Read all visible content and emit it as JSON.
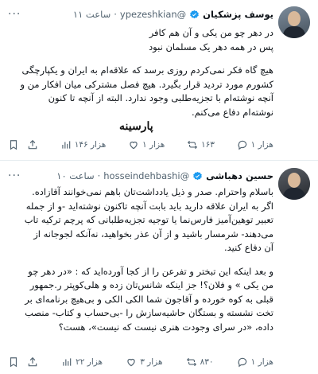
{
  "tweets": [
    {
      "name": "یوسف پزشکیان",
      "handle": "@ypezeshkian",
      "time": "ساعت ۱۱",
      "lines": [
        "در دهر چو من یکی و آن هم کافر",
        "پس در همه دهر یک مسلمان نبود"
      ],
      "lines2": [
        "هیچ گاه فکر نمی‌کردم روزی برسد که علاقه‌ام به ایران و یکپارچگی",
        "کشورم مورد تردید قرار بگیرد. هیچ فصل مشترکی میان افکار من و",
        "آنچه نوشته‌ام با تجزیه‌طلبی وجود ندارد. البته از آنچه تا کنون",
        "نوشته‌ام دفاع می‌کنم."
      ],
      "watermark": "پارسینه",
      "actions": {
        "replies": "هزار ۱",
        "retweets": "۱۶۳",
        "likes": "هزار ۱",
        "views": "هزار ۱۴۶"
      }
    },
    {
      "name": "حسین دهباشی",
      "handle": "@hosseindehbashi",
      "time": "ساعت ۱۰",
      "paras": [
        [
          "باسلام واحترام. صدر و ذیل یادداشت‌تان باهم نمی‌خوانند آقازاده.",
          "اگر به ایران علاقه دارید باید بابت آنچه تاکنون نوشته‌اید -و از جمله",
          "تعبیر توهین‌آمیز فارس‌نما یا توجیه تجزیه‌طلبانی که پرچم ترکیه تاب",
          "می‌دهند- شرمسار باشید و از آن عذر بخواهید، نه‌آنکه لجوجانه از",
          "آن دفاع کنید."
        ],
        [
          "و بعد اینکه این تبختر و تفرعن را از کجا آورده‌اید که : «در دهر چو",
          "من یکی » و فلان؟! جز اینکه شانس‌تان زده و هلی‌کوپتر ر.جمهور",
          "قبلی به کوه خورده و آقاجون شما الکی الکی و بی‌هیچ برنامه‌ای بر",
          "تخت نشسته و بستگان حاشیه‌سازش را -بی‌حساب و کتاب- منصب",
          "داده، «در سرای وجودت هنری نیست که نیست»، هست؟"
        ]
      ],
      "actions": {
        "replies": "هزار ۱",
        "retweets": "۸۳۰",
        "likes": "هزار ۳",
        "views": "هزار ۲۲"
      }
    }
  ],
  "more_label": "···",
  "colors": {
    "text": "#0f1419",
    "muted": "#536471",
    "verified": "#1d9bf0",
    "divider": "#e6ecf0"
  }
}
